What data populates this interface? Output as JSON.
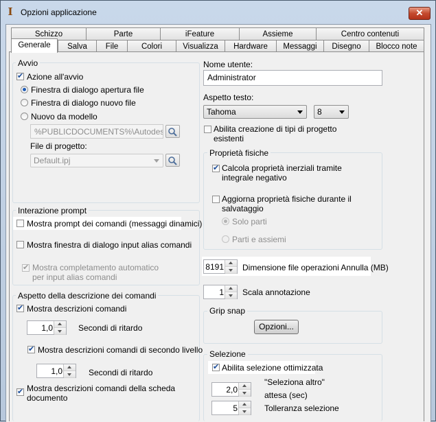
{
  "window": {
    "title": "Opzioni applicazione",
    "close": "✕",
    "app_icon": "I"
  },
  "tabs_row1": [
    "Schizzo",
    "Parte",
    "iFeature",
    "Assieme",
    "Centro contenuti"
  ],
  "tabs_row2": [
    "Generale",
    "Salva",
    "File",
    "Colori",
    "Visualizza",
    "Hardware",
    "Messaggi",
    "Disegno",
    "Blocco note"
  ],
  "active_tab": "Generale",
  "avvio": {
    "title": "Avvio",
    "azione": "Azione all'avvio",
    "radio1": "Finestra di dialogo apertura file",
    "radio2": "Finestra di dialogo nuovo file",
    "radio3": "Nuovo da modello",
    "template_path": "%PUBLICDOCUMENTS%\\Autodesk\\Inv",
    "file_progetto_label": "File di progetto:",
    "file_progetto_value": "Default.ipj"
  },
  "interazione": {
    "title": "Interazione prompt",
    "prompt": "Mostra prompt dei comandi (messaggi dinamici)",
    "alias": "Mostra finestra di dialogo input alias comandi",
    "autocomp_1": "Mostra completamento automatico",
    "autocomp_2": "per input alias comandi"
  },
  "descrizione": {
    "title": "Aspetto della descrizione dei comandi",
    "mostra": "Mostra descrizioni comandi",
    "delay1": "1,0",
    "delay1_label": "Secondi di ritardo",
    "secondo_livello": "Mostra descrizioni comandi di secondo livello",
    "delay2": "1,0",
    "delay2_label": "Secondi di ritardo",
    "scheda_1": "Mostra descrizioni comandi della scheda",
    "scheda_2": "documento"
  },
  "right": {
    "nome_label": "Nome utente:",
    "nome_value": "Administrator",
    "aspetto_label": "Aspetto testo:",
    "font_value": "Tahoma",
    "size_value": "8",
    "tipi_1": "Abilita creazione di tipi di progetto",
    "tipi_2": "esistenti",
    "fisiche_title": "Proprietà fisiche",
    "calcola_1": "Calcola proprietà inerziali tramite",
    "calcola_2": "integrale negativo",
    "aggiorna_1": "Aggiorna proprietà fisiche durante il",
    "aggiorna_2": "salvataggio",
    "solo_parti": "Solo parti",
    "parti_assiemi": "Parti e assiemi",
    "undo_value": "8191",
    "undo_label": "Dimensione file operazioni Annulla (MB)",
    "scala_value": "1",
    "scala_label": "Scala annotazione",
    "grip_title": "Grip snap",
    "opzioni_btn": "Opzioni...",
    "selezione_title": "Selezione",
    "ottimizzata": "Abilita selezione ottimizzata",
    "attesa_value": "2,0",
    "attesa_1": "\"Seleziona altro\"",
    "attesa_2": "attesa (sec)",
    "tolleranza_value": "5",
    "tolleranza_label": "Tolleranza selezione"
  }
}
